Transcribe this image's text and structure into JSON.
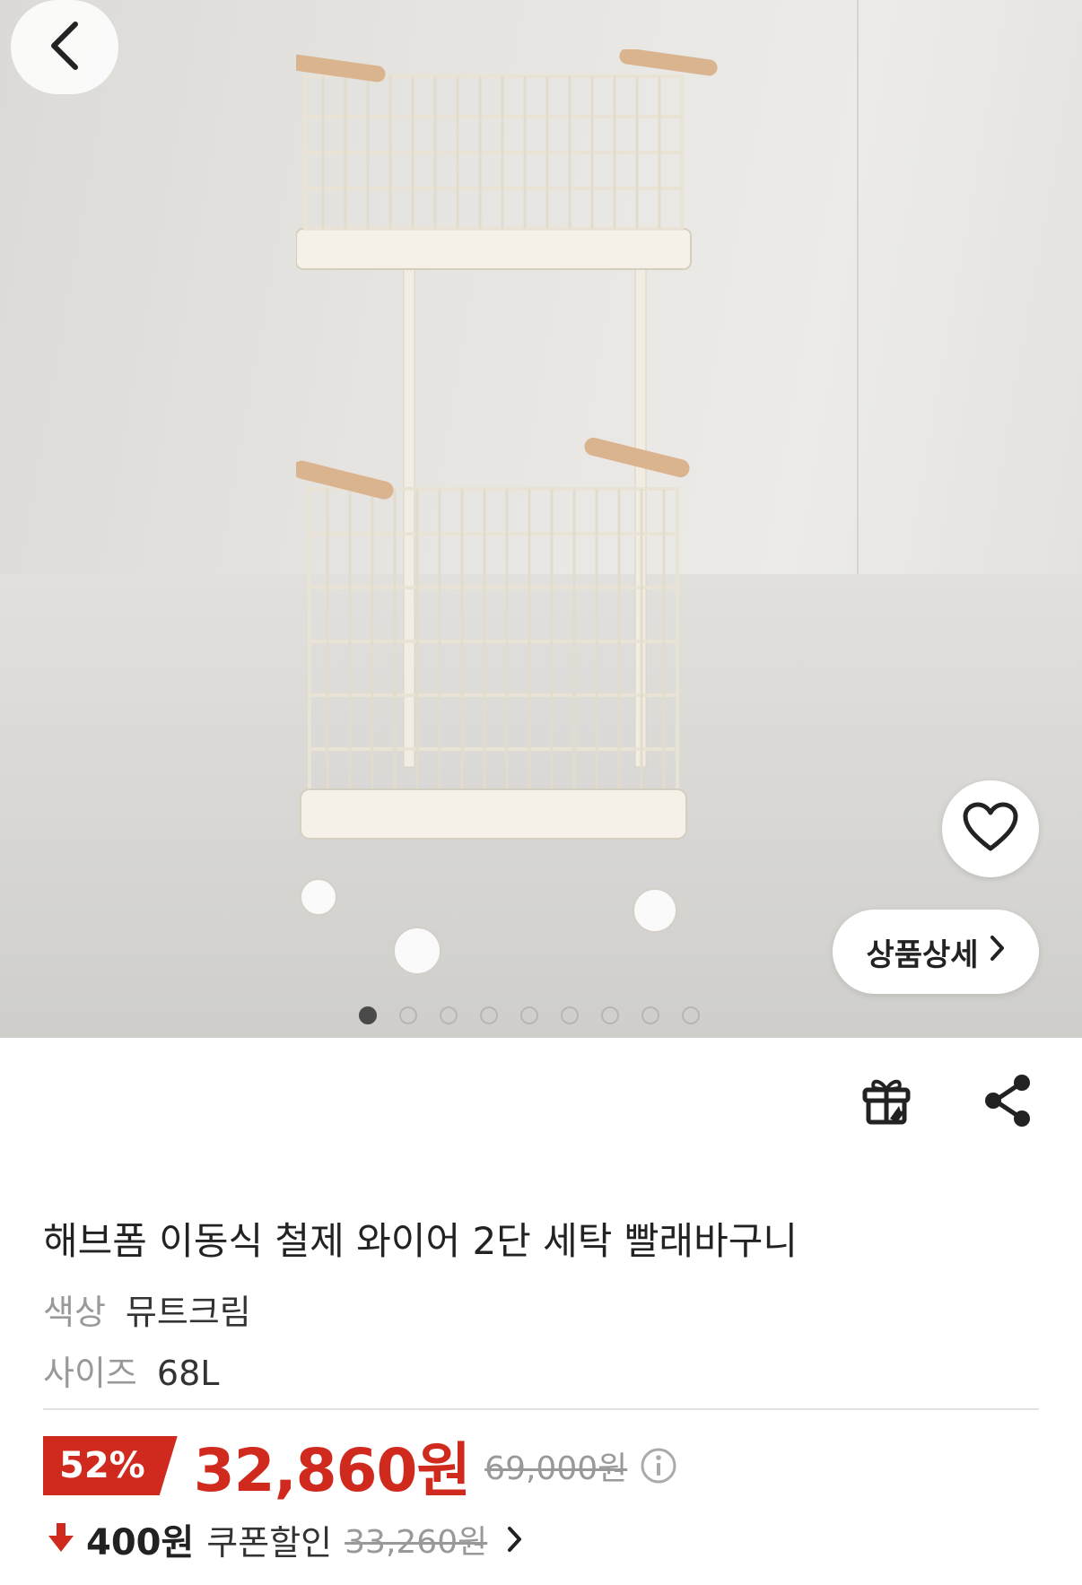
{
  "gallery": {
    "page_count": 9,
    "active_index": 0,
    "detail_button_label": "상품상세"
  },
  "product": {
    "title": "해브폼 이동식 철제 와이어 2단 세탁 빨래바구니",
    "options": [
      {
        "label": "색상",
        "value": "뮤트크림"
      },
      {
        "label": "사이즈",
        "value": "68L"
      }
    ]
  },
  "pricing": {
    "discount_rate": "52%",
    "sale_price": "32,860원",
    "original_price": "69,000원",
    "coupon_amount": "400원",
    "coupon_label": "쿠폰할인",
    "pre_coupon_price": "33,260원"
  },
  "icons": {
    "back": "chevron-left-icon",
    "wishlist": "heart-outline-icon",
    "gift": "gift-icon",
    "share": "share-icon",
    "info": "info-icon",
    "coupon": "arrow-down-icon"
  },
  "colors": {
    "accent_red": "#d02a1e",
    "muted_gray": "#999999"
  }
}
